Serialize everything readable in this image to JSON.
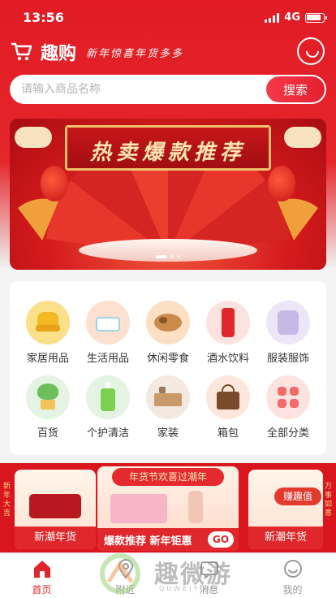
{
  "status_bar": {
    "time": "13:56",
    "network": "4G"
  },
  "header": {
    "brand": "趣购",
    "slogan": "新年惊喜年货多多"
  },
  "search": {
    "placeholder": "请输入商品名称",
    "value": "",
    "button": "搜索"
  },
  "banner": {
    "title": "热卖爆款推荐",
    "slides": 3,
    "active_slide": 0
  },
  "categories": [
    {
      "label": "家居用品",
      "icon": "armchair-icon",
      "color": "#fbe08a"
    },
    {
      "label": "生活用品",
      "icon": "tissue-box-icon",
      "color": "#fde0cf"
    },
    {
      "label": "休闲零食",
      "icon": "snack-bowl-icon",
      "color": "#fde0c4"
    },
    {
      "label": "酒水饮料",
      "icon": "soda-can-icon",
      "color": "#fde3df"
    },
    {
      "label": "服装服饰",
      "icon": "down-jacket-icon",
      "color": "#ece6f6"
    },
    {
      "label": "百货",
      "icon": "succulent-plant-icon",
      "color": "#e4f3e2"
    },
    {
      "label": "个护清洁",
      "icon": "hand-soap-icon",
      "color": "#e3f4e3"
    },
    {
      "label": "家装",
      "icon": "cabinet-icon",
      "color": "#f4e9e0"
    },
    {
      "label": "箱包",
      "icon": "handbag-icon",
      "color": "#fde6dc"
    },
    {
      "label": "全部分类",
      "icon": "grid-icon",
      "color": "#fde3df"
    }
  ],
  "promo": {
    "left_label": "新潮年货",
    "left_side_text": "新年大吉",
    "center_tag": "年货节欢喜过潮年",
    "center_bar": "爆款推荐 新年钜惠",
    "center_go": "GO",
    "right_badge": "赚趣值",
    "right_label": "新潮年货",
    "right_side_text": "万事如意"
  },
  "tabbar": [
    {
      "label": "首页",
      "icon": "home-icon",
      "active": true
    },
    {
      "label": "附近",
      "icon": "location-icon",
      "active": false
    },
    {
      "label": "消息",
      "icon": "message-icon",
      "active": false
    },
    {
      "label": "我的",
      "icon": "profile-icon",
      "active": false
    }
  ],
  "watermark": {
    "text": "趣微游",
    "sub": "QUWEIYOU"
  },
  "colors": {
    "primary": "#e21b24",
    "active_tab": "#e0272b"
  }
}
